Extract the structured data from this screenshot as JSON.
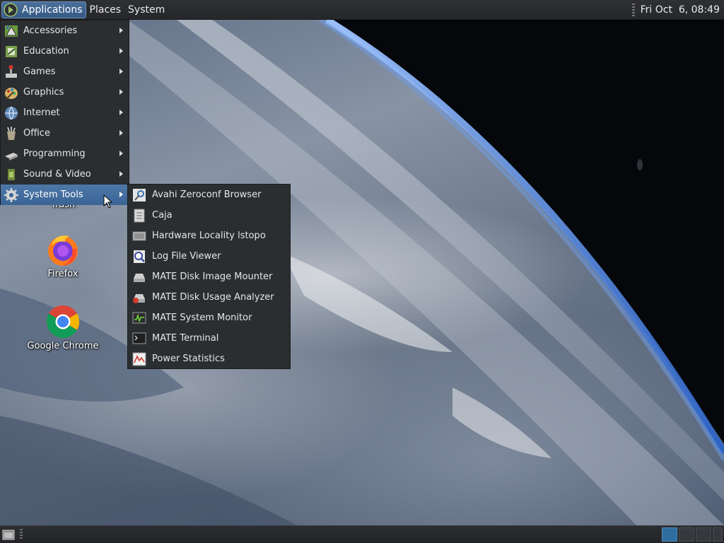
{
  "top_panel": {
    "applications_label": "Applications",
    "places_label": "Places",
    "system_label": "System",
    "clock": "Fri Oct  6, 08:49"
  },
  "apps_menu": {
    "items": [
      {
        "label": "Accessories",
        "icon": "accessories-icon"
      },
      {
        "label": "Education",
        "icon": "education-icon"
      },
      {
        "label": "Games",
        "icon": "games-icon"
      },
      {
        "label": "Graphics",
        "icon": "graphics-icon"
      },
      {
        "label": "Internet",
        "icon": "internet-icon"
      },
      {
        "label": "Office",
        "icon": "office-icon"
      },
      {
        "label": "Programming",
        "icon": "programming-icon"
      },
      {
        "label": "Sound & Video",
        "icon": "sound-video-icon"
      },
      {
        "label": "System Tools",
        "icon": "system-tools-icon",
        "active": true
      }
    ]
  },
  "system_tools_menu": {
    "items": [
      {
        "label": "Avahi Zeroconf Browser",
        "icon": "avahi-icon"
      },
      {
        "label": "Caja",
        "icon": "caja-icon"
      },
      {
        "label": "Hardware Locality lstopo",
        "icon": "hardware-icon"
      },
      {
        "label": "Log File Viewer",
        "icon": "log-viewer-icon"
      },
      {
        "label": "MATE Disk Image Mounter",
        "icon": "disk-mounter-icon"
      },
      {
        "label": "MATE Disk Usage Analyzer",
        "icon": "disk-usage-icon"
      },
      {
        "label": "MATE System Monitor",
        "icon": "system-monitor-icon"
      },
      {
        "label": "MATE Terminal",
        "icon": "terminal-icon"
      },
      {
        "label": "Power Statistics",
        "icon": "power-statistics-icon"
      }
    ]
  },
  "desktop": {
    "icons": [
      {
        "label": "Trash",
        "icon": "trash-icon"
      },
      {
        "label": "Firefox",
        "icon": "firefox-icon"
      },
      {
        "label": "Google Chrome",
        "icon": "chrome-icon"
      }
    ]
  },
  "colors": {
    "menu_highlight": "#3f6a9a",
    "menu_bg": "#2b2e31",
    "panel_bg": "#2a2c2f"
  }
}
